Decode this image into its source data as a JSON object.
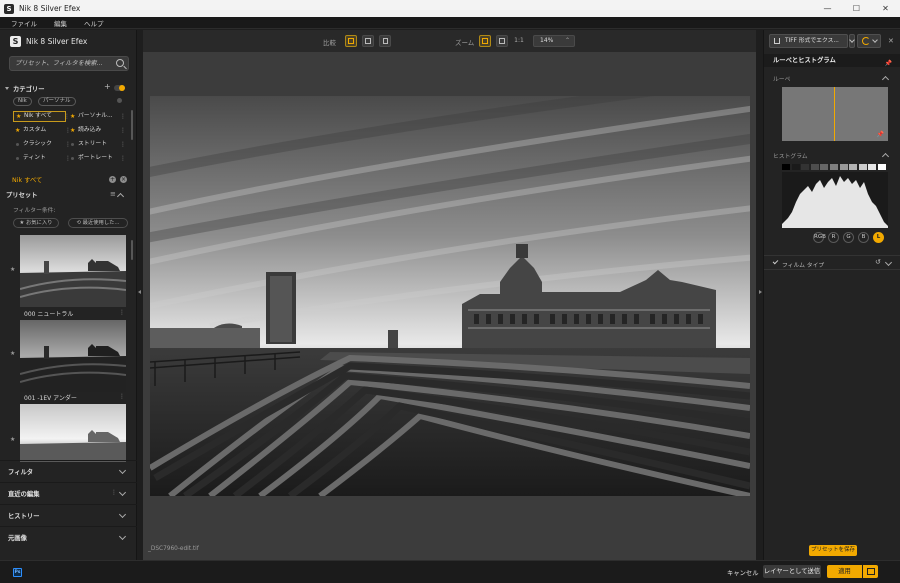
{
  "window": {
    "title": "Nik 8 Silver Efex",
    "minimize": "—",
    "maximize": "☐",
    "close": "✕"
  },
  "menu": [
    "ファイル",
    "編集",
    "ヘルプ"
  ],
  "left": {
    "brand": "Nik 8 Silver Efex",
    "search_placeholder": "プリセット、フィルタを検索...",
    "category_header": "カテゴリー",
    "category_add": "+",
    "chips": [
      "Nik",
      "パーソナル"
    ],
    "categories": [
      {
        "label": "Nik すべて",
        "starred": true,
        "active": true
      },
      {
        "label": "パーソナル...",
        "starred": true,
        "active": false
      },
      {
        "label": "カスタム",
        "starred": true,
        "active": false
      },
      {
        "label": "読み込み",
        "starred": true,
        "active": false
      },
      {
        "label": "クラシック",
        "starred": false,
        "active": false
      },
      {
        "label": "ストリート",
        "starred": false,
        "active": false
      },
      {
        "label": "ティント",
        "starred": false,
        "active": false
      },
      {
        "label": "ポートレート",
        "starred": false,
        "active": false
      }
    ],
    "current_category": "Nik すべて",
    "presets_header": "プリセット",
    "filter_label": "フィルター条件:",
    "filter_pills": [
      "★ お気に入り",
      "⟲ 最近使用した..."
    ],
    "presets": [
      {
        "name": "000 ニュートラル"
      },
      {
        "name": "001 -1EV アンダー"
      },
      {
        "name": ""
      }
    ],
    "folds": [
      "フィルタ",
      "直近の編集",
      "ヒストリー",
      "元画像"
    ]
  },
  "center": {
    "compare_label": "比較",
    "zoom_label": "ズーム",
    "zoom_one_to_one": "1:1",
    "zoom_value": "14%",
    "filename": "_DSC7960-edit.tif"
  },
  "right": {
    "export_label": "TIFF 形式でエクス...",
    "panel_title": "ルーペとヒストグラム",
    "loupe_label": "ルーペ",
    "histogram_label": "ヒストグラム",
    "channels": [
      "RGB",
      "R",
      "G",
      "B",
      "L"
    ],
    "active_channel": "L",
    "film_type": "フィルム タイプ",
    "save_preset": "プリセットを保存"
  },
  "bottom": {
    "ps_badge": "Ps",
    "cancel": "キャンセル",
    "send_layer": "レイヤーとして送信",
    "apply": "適用"
  },
  "colors": {
    "accent": "#f2a900",
    "panel": "#232323",
    "canvas": "#3c3c3c"
  },
  "icons": [
    "search-icon",
    "gear-icon",
    "pin-icon",
    "photoshop-icon",
    "close-icon",
    "chevron-down-icon"
  ]
}
